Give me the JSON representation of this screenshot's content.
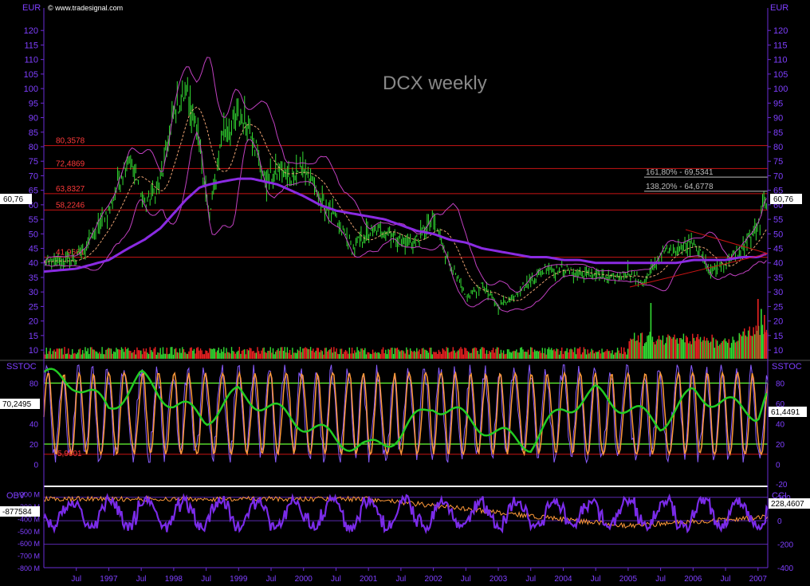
{
  "colors": {
    "background": "#000000",
    "axis": "#6a2bd6",
    "price_axis_label": "#7f3fff",
    "candle": "#33dd33",
    "fib_line": "#c81414",
    "fib_label": "#ff3a3a",
    "ma_long": "#8a2be2",
    "bollinger": "#c040c0",
    "ma_short": "#e8a070",
    "volume_up": "#33dd33",
    "volume_down": "#ee2222",
    "sstoc_fast": "#8a5cff",
    "sstoc_k": "#ff9a3a",
    "sstoc_slow": "#22cc22",
    "sstoc_level": "#66ff33",
    "obv": "#7a2be8",
    "cci": "#ff9a3a",
    "panel_divider": "#ffffff",
    "last_value_box": "#ffffff",
    "title": "#888888"
  },
  "header": {
    "copyright": "© www.tradesignal.com",
    "title": "DCX weekly"
  },
  "price_panel": {
    "axis_label_left": "EUR",
    "axis_label_right": "EUR",
    "ticks": [
      10,
      15,
      20,
      25,
      30,
      35,
      40,
      45,
      50,
      55,
      60,
      65,
      70,
      75,
      80,
      85,
      90,
      95,
      100,
      105,
      110,
      115,
      120
    ],
    "last_value_left": "60,76",
    "last_value_right": "60,76",
    "fib_levels": [
      {
        "value": 80.3578,
        "label": "80,3578"
      },
      {
        "value": 72.4869,
        "label": "72,4869"
      },
      {
        "value": 63.8327,
        "label": "63,8327"
      },
      {
        "value": 58.2246,
        "label": "58,2246"
      },
      {
        "value": 41.9661,
        "label": "41,9661"
      }
    ],
    "projections": [
      {
        "value": 69.5341,
        "label": "161,80% - 69,5341"
      },
      {
        "value": 64.6778,
        "label": "138,20% - 64,6778"
      }
    ]
  },
  "sstoc_panel": {
    "name_left": "SSTOC",
    "name_right": "SSTOC",
    "ticks": [
      0,
      20,
      40,
      60,
      80
    ],
    "tick_extra_right": "-20",
    "levels": [
      80,
      20
    ],
    "last_value_left": "70,2495",
    "last_value_right": "61,4491",
    "low_label": "5,9601"
  },
  "obv_panel": {
    "name_left": "OBV",
    "name_right": "CCI",
    "left_ticks": [
      "-200 M",
      "-300 M",
      "-400 M",
      "-500 M",
      "-600 M",
      "-700 M",
      "-800 M"
    ],
    "left_tick_values": [
      -200,
      -300,
      -400,
      -500,
      -600,
      -700,
      -800
    ],
    "right_ticks": [
      "200",
      "0",
      "-200",
      "-400"
    ],
    "right_tick_values": [
      200,
      0,
      -200,
      -400
    ],
    "last_value_left": "-877584",
    "last_value_right": "228,4607"
  },
  "x_axis": {
    "labels": [
      "Jul",
      "1997",
      "Jul",
      "1998",
      "Jul",
      "1999",
      "Jul",
      "2000",
      "Jul",
      "2001",
      "Jul",
      "2002",
      "Jul",
      "2003",
      "Jul",
      "2004",
      "Jul",
      "2005",
      "Jul",
      "2006",
      "Jul",
      "2007"
    ],
    "times": [
      1996.5,
      1997,
      1997.5,
      1998,
      1998.5,
      1999,
      1999.5,
      2000,
      2000.5,
      2001,
      2001.5,
      2002,
      2002.5,
      2003,
      2003.5,
      2004,
      2004.5,
      2005,
      2005.5,
      2006,
      2006.5,
      2007
    ]
  },
  "chart_data": [
    {
      "type": "candlestick",
      "title": "DCX weekly",
      "ylabel": "EUR",
      "ylim": [
        7,
        125
      ],
      "x_range": [
        1996.0,
        2007.15
      ],
      "x": [
        1996.0,
        1996.5,
        1997.0,
        1997.3,
        1997.55,
        1997.8,
        1998.0,
        1998.2,
        1998.4,
        1998.55,
        1998.75,
        1999.0,
        1999.2,
        1999.4,
        1999.6,
        1999.8,
        2000.0,
        2000.25,
        2000.5,
        2000.75,
        2001.0,
        2001.25,
        2001.5,
        2001.75,
        2002.0,
        2002.25,
        2002.5,
        2002.75,
        2003.0,
        2003.25,
        2003.5,
        2003.75,
        2004.0,
        2004.25,
        2004.5,
        2004.75,
        2005.0,
        2005.25,
        2005.5,
        2005.75,
        2006.0,
        2006.25,
        2006.5,
        2006.75,
        2007.0,
        2007.1
      ],
      "close": [
        40,
        41,
        58,
        77,
        60,
        68,
        92,
        100,
        80,
        55,
        85,
        90,
        86,
        68,
        72,
        70,
        73,
        62,
        55,
        45,
        50,
        52,
        47,
        48,
        55,
        40,
        28,
        32,
        25,
        29,
        34,
        38,
        38,
        36,
        36,
        34,
        37,
        33,
        43,
        45,
        48,
        37,
        40,
        45,
        52,
        60.76
      ],
      "sma_long": [
        37,
        38,
        41,
        45,
        48,
        52,
        57,
        62,
        66,
        67,
        68,
        69,
        69,
        68,
        67,
        65,
        63,
        60,
        58,
        57,
        56,
        55,
        53,
        51,
        50,
        48,
        47,
        45,
        44,
        43,
        42,
        42,
        41,
        41,
        40,
        40,
        40,
        40,
        40,
        40,
        41,
        41,
        41,
        42,
        42,
        43
      ]
    },
    {
      "type": "bar",
      "title": "Volume",
      "ylim": [
        0,
        30
      ],
      "note": "volume bars overlaid at bottom of price panel, green up / red down",
      "x": [
        2005.35,
        2007.0,
        2007.05,
        2007.1
      ],
      "values": [
        28,
        30,
        25,
        22
      ]
    },
    {
      "type": "line",
      "title": "SSTOC",
      "ylim": [
        -20,
        100
      ],
      "levels": [
        80,
        20
      ],
      "series": [
        {
          "name": "Fast",
          "color": "#8a5cff"
        },
        {
          "name": "%K",
          "color": "#ff9a3a"
        },
        {
          "name": "Slow",
          "color": "#22cc22",
          "x": [
            1996.0,
            1996.5,
            1997.0,
            1997.5,
            1998.0,
            1998.5,
            1999.0,
            1999.5,
            2000.0,
            2000.5,
            2001.0,
            2001.5,
            2002.0,
            2002.5,
            2003.0,
            2003.5,
            2004.0,
            2004.5,
            2005.0,
            2005.5,
            2006.0,
            2006.5,
            2007.0,
            2007.12
          ],
          "values": [
            88,
            80,
            55,
            85,
            60,
            45,
            70,
            55,
            40,
            25,
            15,
            30,
            60,
            45,
            30,
            20,
            55,
            70,
            55,
            40,
            70,
            60,
            50,
            70
          ]
        }
      ],
      "last_values": [
        70.2495,
        61.4491
      ]
    },
    {
      "type": "line",
      "title": "OBV / CCI",
      "series": [
        {
          "name": "OBV",
          "color": "#7a2be8"
        },
        {
          "name": "CCI",
          "color": "#ff9a3a"
        }
      ],
      "left_ylim": [
        -800,
        -150
      ],
      "right_ylim": [
        -400,
        280
      ],
      "last_values": [
        -877584,
        228.4607
      ]
    }
  ]
}
